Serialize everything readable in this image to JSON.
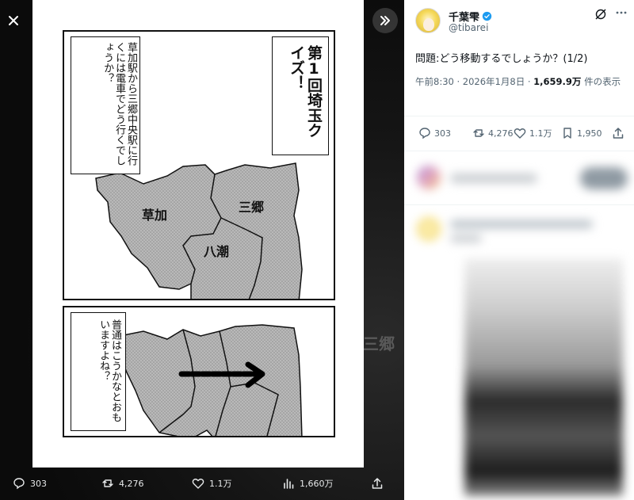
{
  "media": {
    "close_icon": "close-icon",
    "expand_icon": "chevrons-right-icon",
    "ghost_text": "三郷",
    "panel1": {
      "balloon_left": "草加駅から三郷中央駅に行くには電車でどう行くでしょうか？",
      "balloon_title": "第1回埼玉クイズ！",
      "map_labels": [
        "草加",
        "三郷",
        "八潮"
      ]
    },
    "panel2": {
      "balloon": "普通はこうかなとおもいますよね？"
    },
    "bottom": {
      "replies": "303",
      "reposts": "4,276",
      "likes": "1.1万",
      "views": "1,660万"
    }
  },
  "tweet": {
    "display_name": "千葉雫",
    "handle": "@tibarei",
    "text": "問題:どう移動するでしょうか？(1/2)",
    "time": "午前8:30 · 2026年1月8日 · ",
    "views_count": "1,659.9万",
    "views_label": " 件の表示",
    "actions": {
      "replies": "303",
      "reposts": "4,276",
      "likes": "1.1万",
      "bookmarks": "1,950"
    },
    "accent_color": "#1d9bf0"
  }
}
